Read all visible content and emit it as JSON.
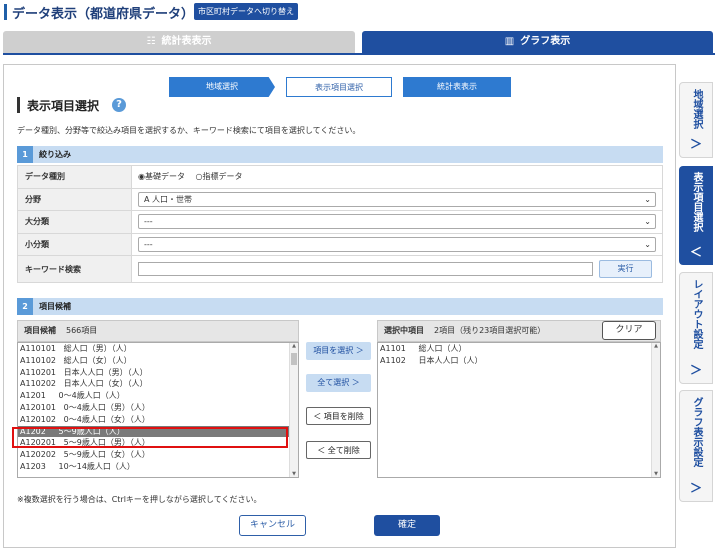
{
  "header": {
    "title": "データ表示（都道府県データ）",
    "switch_label": "市区町村データへ切り替え"
  },
  "tabs": {
    "table_label": "統計表表示",
    "graph_label": "グラフ表示"
  },
  "steps": [
    "地域選択",
    "表示項目選択",
    "統計表表示"
  ],
  "section": {
    "title": "表示項目選択",
    "help": "?",
    "description": "データ種別、分野等で絞込み項目を選択するか、キーワード検索にて項目を選択してください。"
  },
  "filter": {
    "num": "1",
    "label": "絞り込み",
    "data_type_label": "データ種別",
    "data_type_options": [
      "基礎データ",
      "指標データ"
    ],
    "field_label": "分野",
    "field_value": "A 人口・世帯",
    "major_label": "大分類",
    "major_value": "---",
    "minor_label": "小分類",
    "minor_value": "---",
    "keyword_label": "キーワード検索",
    "keyword_value": "",
    "run_label": "実行"
  },
  "candidates": {
    "num": "2",
    "label": "項目候補",
    "list_title": "項目候補",
    "count": "566項目",
    "items": [
      "A110101   総人口（男）（人）",
      "A110102   総人口（女）（人）",
      "A110201   日本人人口（男）（人）",
      "A110202   日本人人口（女）（人）",
      "A1201     0～4歳人口（人）",
      "A120101   0～4歳人口（男）（人）",
      "A120102   0～4歳人口（女）（人）",
      "A1202     5～9歳人口（人）",
      "A120201   5～9歳人口（男）（人）",
      "A120202   5～9歳人口（女）（人）",
      "A1203     10～14歳人口（人）"
    ],
    "selected_index": 7
  },
  "buttons": {
    "select_item": "項目を選択 ＞",
    "select_all": "全て選択 ＞",
    "remove_item": "＜ 項目を削除",
    "remove_all": "＜ 全て削除",
    "clear": "クリア",
    "cancel": "キャンセル",
    "ok": "確定"
  },
  "selected": {
    "title": "選択中項目",
    "count": "2項目",
    "remaining": "（残り23項目選択可能）",
    "items": [
      "A1101     総人口（人）",
      "A1102     日本人人口（人）"
    ]
  },
  "note": "※複数選択を行う場合は、Ctrlキーを押しながら選択してください。",
  "side_tabs": [
    {
      "label": "地域選択",
      "arrow": "＞"
    },
    {
      "label": "表示項目選択",
      "arrow": "＜"
    },
    {
      "label": "レイアウト設定",
      "arrow": "＞"
    },
    {
      "label": "グラフ表示設定",
      "arrow": "＞"
    }
  ],
  "colors": {
    "brand": "#1f4fa0",
    "step": "#2e7ad0",
    "band": "#c7dcf2",
    "highlight": "#e01010"
  }
}
